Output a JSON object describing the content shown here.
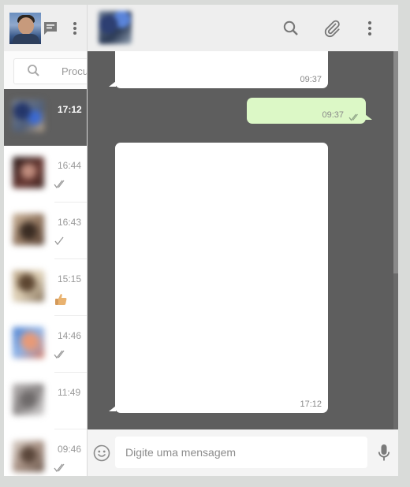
{
  "sidebar": {
    "search_placeholder": "Procurar",
    "chats": [
      {
        "time": "17:12",
        "status": "none",
        "active": true
      },
      {
        "time": "16:44",
        "status": "double-check-icon",
        "active": false
      },
      {
        "time": "16:43",
        "status": "check-icon",
        "active": false
      },
      {
        "time": "15:15",
        "status": "thumbs-up-icon",
        "active": false
      },
      {
        "time": "14:46",
        "status": "double-check-icon",
        "active": false
      },
      {
        "time": "11:49",
        "status": "none",
        "active": false
      },
      {
        "time": "09:46",
        "status": "double-check-icon",
        "active": false
      }
    ]
  },
  "conversation": {
    "messages": [
      {
        "direction": "in",
        "time": "09:37"
      },
      {
        "direction": "out",
        "time": "09:37",
        "status": "double-check-icon"
      },
      {
        "direction": "in",
        "time": "17:12"
      }
    ]
  },
  "composer": {
    "placeholder": "Digite uma mensagem"
  },
  "colors": {
    "header_bg": "#eeeeee",
    "chat_bg": "#5e5e5e",
    "outgoing_bubble": "#dcf8c6",
    "incoming_bubble": "#ffffff",
    "active_chat": "#5f5f5f"
  }
}
